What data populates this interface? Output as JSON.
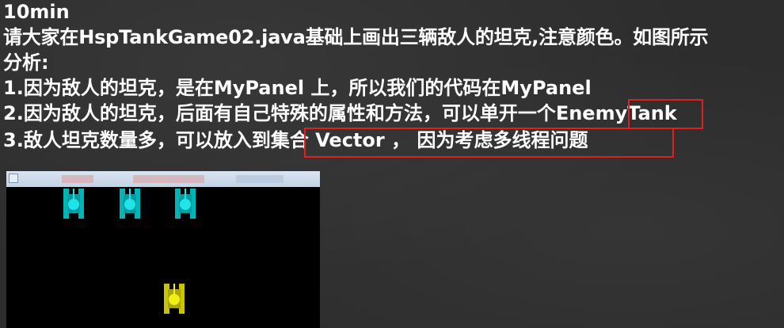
{
  "slide": {
    "time_label": "10min",
    "task": "请大家在HspTankGame02.java基础上画出三辆敌人的坦克,注意颜色。如图所示",
    "analysis_heading": "分析:",
    "points": [
      "1.因为敌人的坦克，是在MyPanel 上，所以我们的代码在MyPanel",
      "2.因为敌人的坦克，后面有自己特殊的属性和方法，可以单开一个EnemyTank",
      "3.敌人坦克数量多，可以放入到集合  Vector ， 因为考虑多线程问题"
    ]
  },
  "game_window": {
    "enemy_tank_color": "#00c8cc",
    "player_tank_color": "#e0dc00",
    "background_color": "#000000",
    "enemy_tank_count": 3,
    "player_tank_count": 1
  },
  "highlight_color": "#e02020"
}
